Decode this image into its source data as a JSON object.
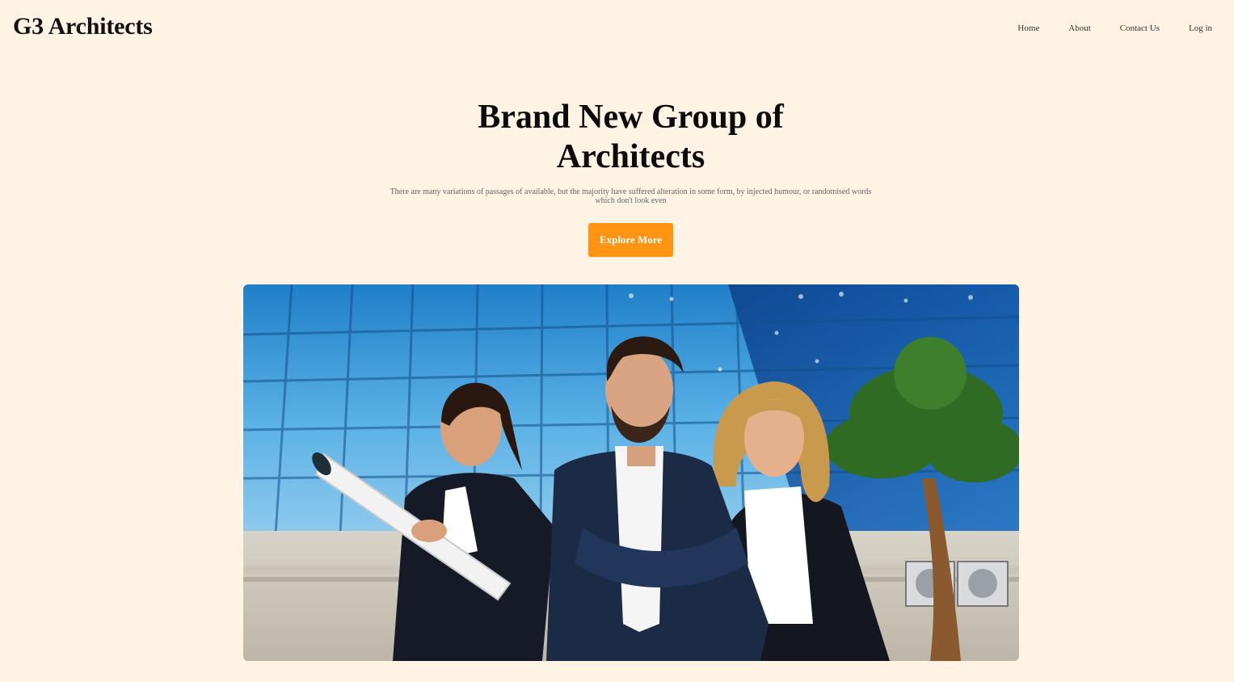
{
  "brand": {
    "name": "G3 Architects"
  },
  "nav": {
    "items": [
      {
        "label": "Home"
      },
      {
        "label": "About"
      },
      {
        "label": "Contact Us"
      },
      {
        "label": "Log in"
      }
    ]
  },
  "hero": {
    "title_line1": "Brand New Group of",
    "title_line2": "Architects",
    "subtitle_line1": "There are many variations of passages of available, but the majority have suffered alteration in some form, by injected humour, or randomised words",
    "subtitle_line2": "which don't look even",
    "cta_label": "Explore More"
  },
  "colors": {
    "page_background": "#fff3e4",
    "accent": "#ff9412"
  }
}
